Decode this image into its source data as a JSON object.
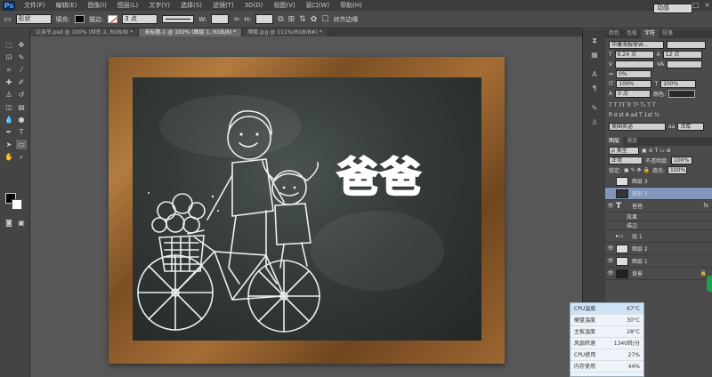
{
  "app": {
    "logo": "Ps"
  },
  "menu": [
    "文件(F)",
    "编辑(E)",
    "图像(I)",
    "图层(L)",
    "文字(Y)",
    "选择(S)",
    "滤镜(T)",
    "3D(D)",
    "视图(V)",
    "窗口(W)",
    "帮助(H)"
  ],
  "window_controls": [
    "–",
    "□",
    "×"
  ],
  "options": {
    "mode": "形状",
    "fill_label": "填充:",
    "stroke_label": "描边:",
    "stroke_width": "3 点",
    "w_label": "W:",
    "h_label": "H:",
    "align_edges": "对齐边缘",
    "workspace": "动感"
  },
  "tabs": [
    {
      "label": "父亲节.psd @ 100% (矩形 2, RGB/8) *",
      "active": false
    },
    {
      "label": "未标题-1 @ 100% (图层 1, RGB/8) *",
      "active": true
    },
    {
      "label": "牌匾.jpg @ 111%(RGB/8#) *",
      "active": false
    }
  ],
  "canvas": {
    "title": "爸爸"
  },
  "panels": {
    "char_tabs": [
      "颜色",
      "色板",
      "字符",
      "段落"
    ],
    "font_family": "华康海报体W...",
    "font_size": "6.24 点",
    "leading": "12 点",
    "tracking": "0%",
    "vscale": "100%",
    "hscale": "100%",
    "baseline": "0 点",
    "color_label": "颜色:",
    "language": "美国英语",
    "aa": "浑厚",
    "layer_tabs": [
      "图层",
      "通道"
    ],
    "layer_kind": "ρ 类型",
    "blend_mode": "正常",
    "opacity_label": "不透明度:",
    "opacity": "100%",
    "lock_label": "锁定:",
    "fill_label": "填充:",
    "fill": "100%",
    "layers": [
      {
        "name": "图层 3",
        "selected": false,
        "visible": false
      },
      {
        "name": "矩形 2",
        "selected": true,
        "visible": false
      },
      {
        "name": "爸爸",
        "selected": false,
        "visible": true,
        "type": "T",
        "fx": "fx"
      },
      {
        "name": "效果",
        "selected": false,
        "visible": true,
        "indent": true
      },
      {
        "name": "描边",
        "selected": false,
        "visible": true,
        "indent": true
      },
      {
        "name": "组 1",
        "selected": false,
        "visible": false,
        "folder": true
      },
      {
        "name": "图层 2",
        "selected": false,
        "visible": true
      },
      {
        "name": "图层 1",
        "selected": false,
        "visible": true
      },
      {
        "name": "背景",
        "selected": false,
        "visible": true,
        "locked": true
      }
    ]
  },
  "sysmon": [
    {
      "label": "CPU温度",
      "value": "67°C"
    },
    {
      "label": "硬盘温度",
      "value": "30°C"
    },
    {
      "label": "主板温度",
      "value": "28°C"
    },
    {
      "label": "风扇转速",
      "value": "1340转/分"
    },
    {
      "label": "CPU使用",
      "value": "27%"
    },
    {
      "label": "内存使用",
      "value": "44%"
    }
  ]
}
